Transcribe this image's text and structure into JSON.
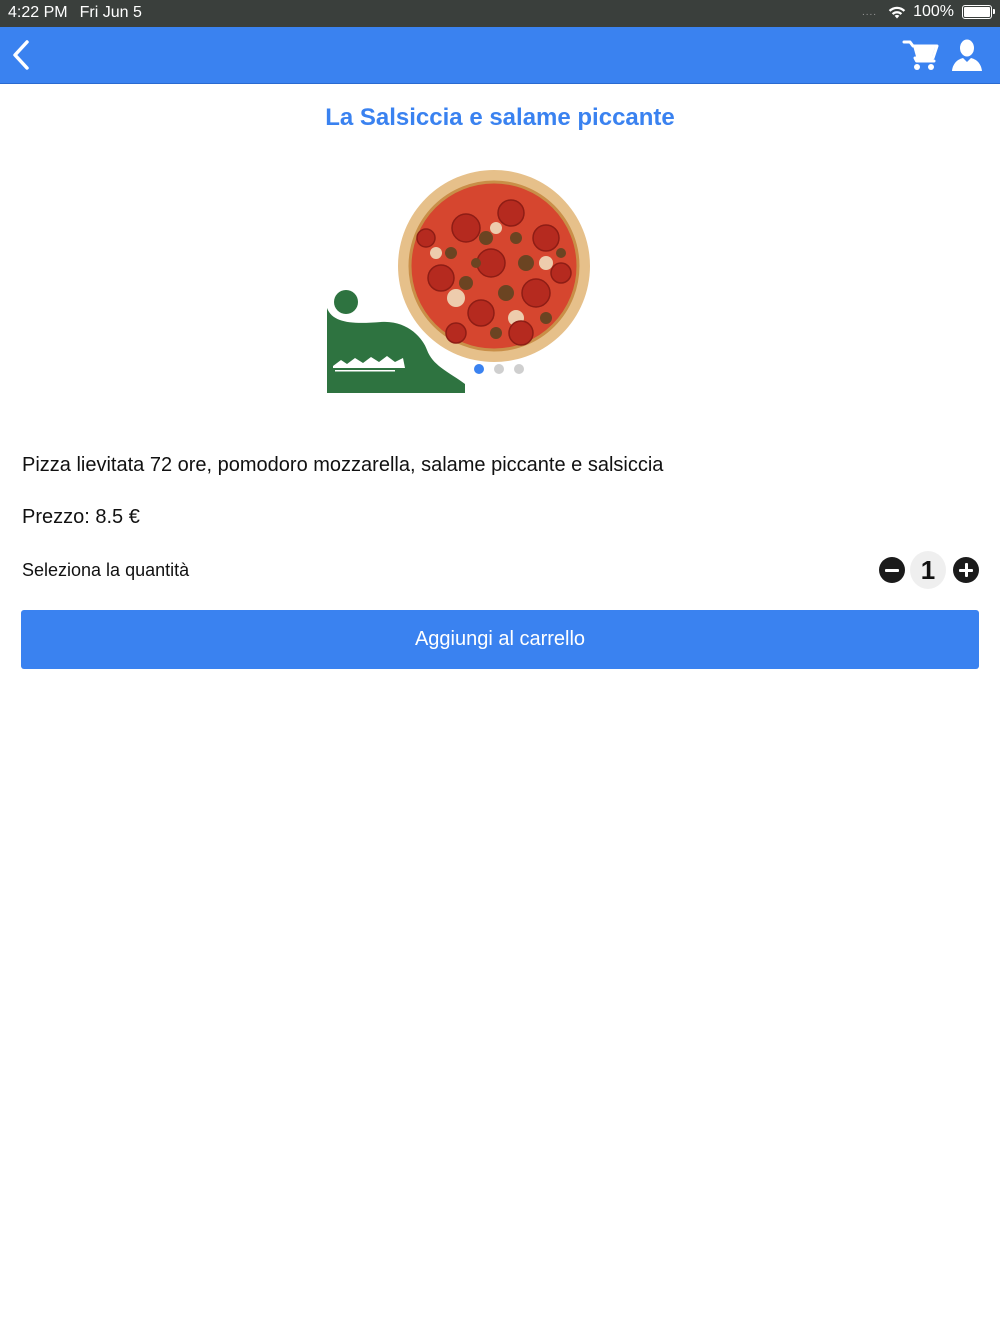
{
  "status_bar": {
    "time": "4:22 PM",
    "date": "Fri Jun 5",
    "battery_percent": "100%",
    "signal": "....",
    "icons": [
      "wifi-icon",
      "battery-icon"
    ]
  },
  "nav": {
    "icons": [
      "back-chevron-icon",
      "cart-icon",
      "user-icon"
    ],
    "background_color": "#3a82f0"
  },
  "product": {
    "title": "La Salsiccia e salame piccante",
    "description": "Pizza lievitata 72 ore, pomodoro mozzarella, salame piccante e salsiccia",
    "price_text": "Prezzo: 8.5 €"
  },
  "carousel": {
    "page_count": 3,
    "active_index": 0
  },
  "quantity": {
    "label": "Seleziona la quantità",
    "value": "1"
  },
  "actions": {
    "add_to_cart": "Aggiungi al carrello"
  },
  "colors": {
    "accent": "#3a82f0",
    "logo_green": "#2e7340",
    "status_bar": "#3a3f3c"
  }
}
